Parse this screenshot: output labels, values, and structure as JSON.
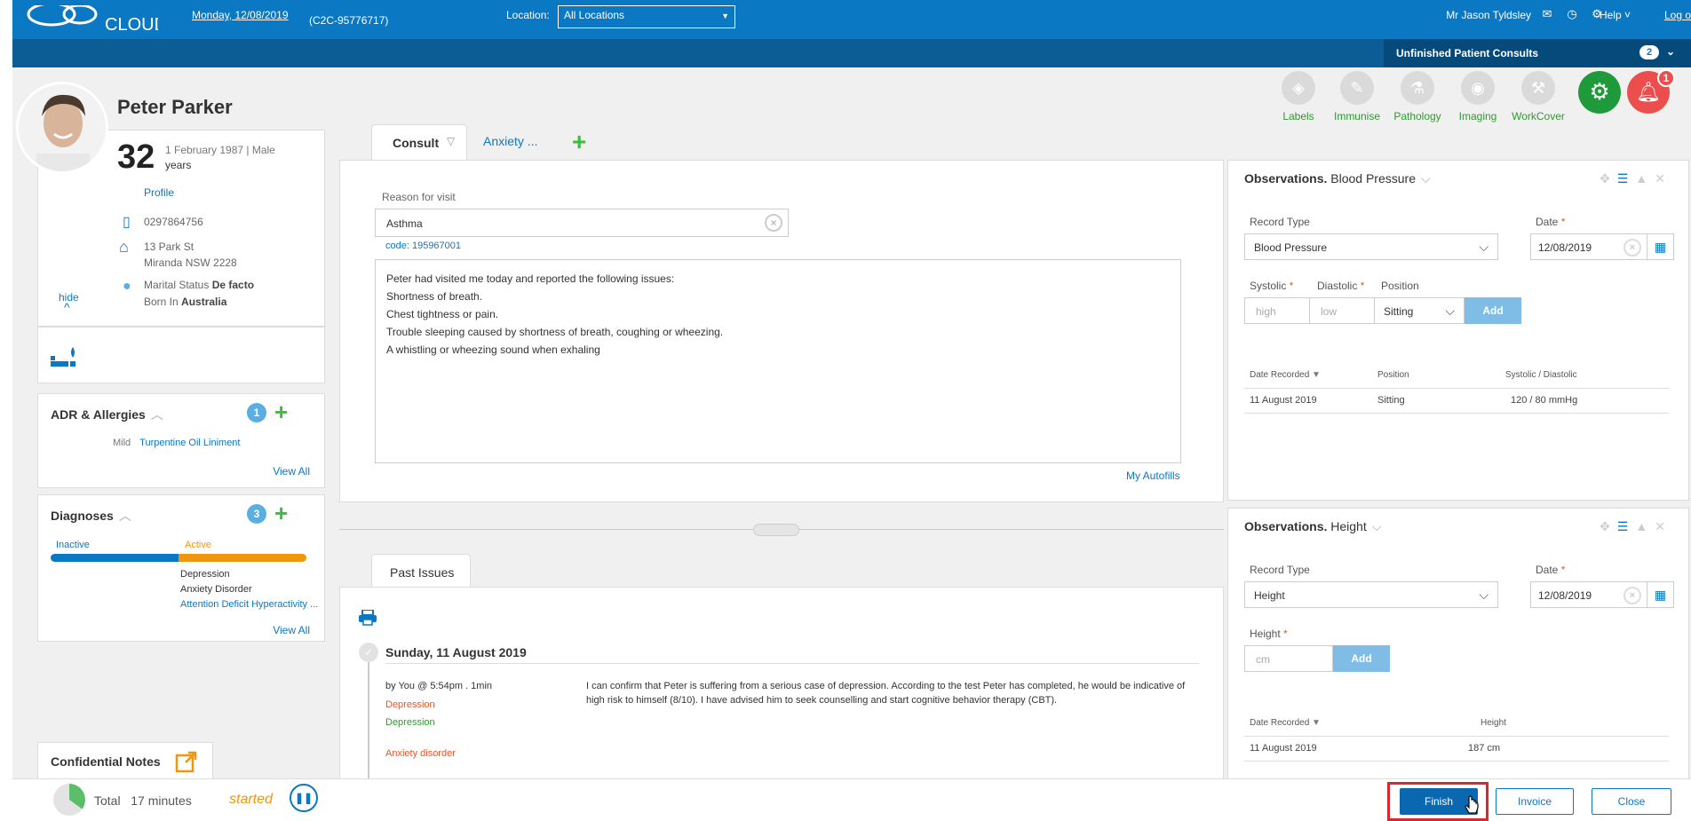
{
  "header": {
    "logo_text": "CLOUD",
    "date": "Monday, 12/08/2019",
    "account": "(C2C-95776717)",
    "location_label": "Location:",
    "location_value": "All Locations",
    "user": "Mr Jason Tyldsley",
    "help": "Help",
    "logout": "Log o",
    "unfinished_label": "Unfinished Patient Consults",
    "unfinished_count": "2"
  },
  "patient": {
    "name": "Peter Parker",
    "age": "32",
    "dob_sex": "1 February 1987 | Male",
    "age_unit": "years",
    "profile_link": "Profile",
    "phone": "0297864756",
    "address_line1": "13 Park St",
    "address_line2": "Miranda NSW 2228",
    "marital_label": "Marital Status",
    "marital_value": "De facto",
    "born_label": "Born In",
    "born_value": "Australia",
    "hide_label": "hide"
  },
  "allergies": {
    "title": "ADR & Allergies",
    "count": "1",
    "items": [
      {
        "severity": "Mild",
        "name": "Turpentine Oil Liniment"
      }
    ],
    "view_all": "View All"
  },
  "diagnoses": {
    "title": "Diagnoses",
    "count": "3",
    "inactive_label": "Inactive",
    "active_label": "Active",
    "inactive_fraction": 0.5,
    "items": [
      "Depression",
      "Anxiety Disorder",
      "Attention Deficit Hyperactivity ..."
    ],
    "view_all": "View All"
  },
  "confidential_notes": {
    "title": "Confidential Notes"
  },
  "tabs": {
    "consult": "Consult",
    "anxiety": "Anxiety ...",
    "past_issues": "Past Issues"
  },
  "consult": {
    "reason_label": "Reason for visit",
    "reason_value": "Asthma",
    "code": "code: 195967001",
    "notes": [
      "Peter had visited me today and reported the following issues:",
      "Shortness of breath.",
      "Chest tightness or pain.",
      "Trouble sleeping caused by shortness of breath, coughing or wheezing.",
      "A whistling or wheezing sound when exhaling"
    ],
    "autofills": "My Autofills"
  },
  "past": {
    "date": "Sunday, 11 August 2019",
    "by": "by You @ 5:54pm  .  1min",
    "dx1": "Depression",
    "dx2": "Depression",
    "dx3": "Anxiety disorder",
    "note": "I can confirm that Peter is suffering from a serious case of depression. According to the test Peter has completed, he would be indicative of high risk to himself (8/10). I have advised him to seek counselling and start cognitive behavior therapy (CBT)."
  },
  "actions": {
    "labels": "Labels",
    "immunise": "Immunise",
    "pathology": "Pathology",
    "imaging": "Imaging",
    "workcover": "WorkCover",
    "notifications": "1"
  },
  "obs_bp": {
    "title_bold": "Observations.",
    "title": "Blood Pressure",
    "record_type_label": "Record Type",
    "record_type": "Blood Pressure",
    "date_label": "Date",
    "date": "12/08/2019",
    "systolic_label": "Systolic",
    "diastolic_label": "Diastolic",
    "position_label": "Position",
    "systolic_placeholder": "high",
    "diastolic_placeholder": "low",
    "position": "Sitting",
    "add": "Add",
    "col_date": "Date Recorded",
    "col_position": "Position",
    "col_value": "Systolic / Diastolic",
    "row": {
      "date": "11 August 2019",
      "position": "Sitting",
      "value": "120 / 80 mmHg"
    }
  },
  "obs_height": {
    "title_bold": "Observations.",
    "title": "Height",
    "record_type_label": "Record Type",
    "record_type": "Height",
    "date_label": "Date",
    "date": "12/08/2019",
    "height_label": "Height",
    "height_placeholder": "cm",
    "add": "Add",
    "col_date": "Date Recorded",
    "col_value": "Height",
    "row": {
      "date": "11 August 2019",
      "value": "187 cm"
    }
  },
  "footer": {
    "total_label": "Total",
    "total_value": "17 minutes",
    "timer_fraction": 0.35,
    "status": "started",
    "finish": "Finish",
    "invoice": "Invoice",
    "close": "Close"
  },
  "colors": {
    "header_blue": "#0a78c2",
    "subbar_blue": "#0c5d96",
    "green": "#38c038",
    "orange": "#f0960e",
    "red": "#e0262a"
  }
}
